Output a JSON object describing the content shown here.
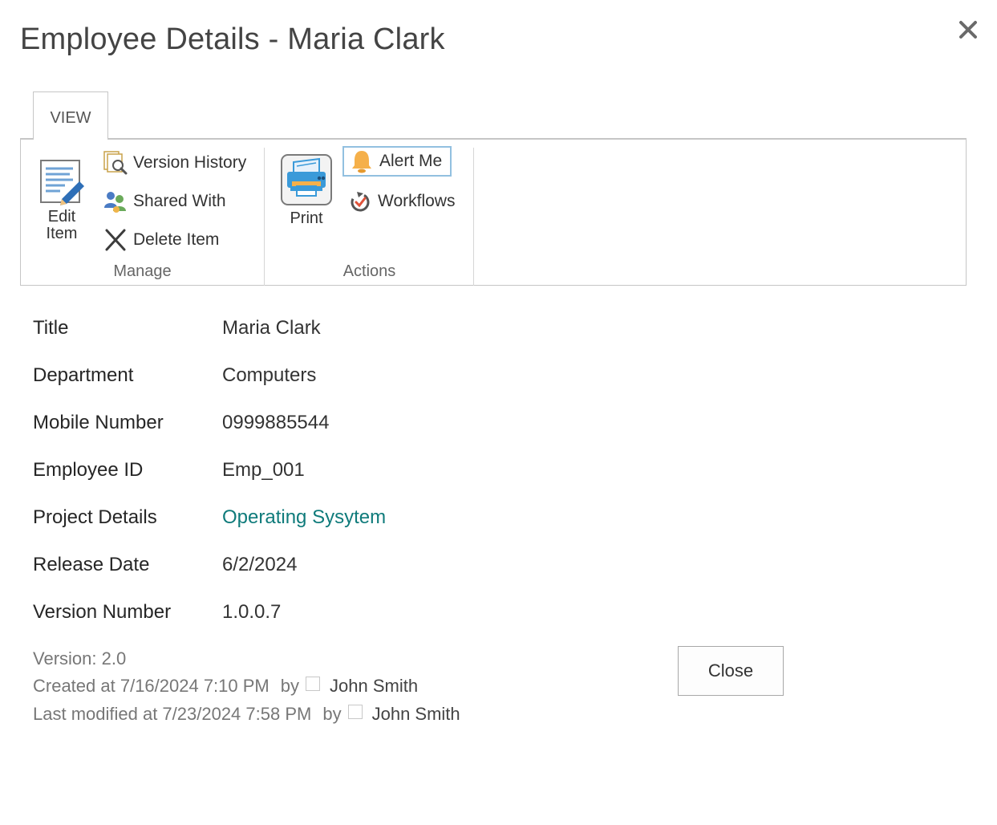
{
  "dialog": {
    "title": "Employee Details - Maria Clark",
    "close_icon": "close-x-icon"
  },
  "ribbon": {
    "tab_label": "VIEW",
    "groups": {
      "manage": {
        "label": "Manage",
        "edit_item_line1": "Edit",
        "edit_item_line2": "Item",
        "version_history": "Version History",
        "shared_with": "Shared With",
        "delete_item": "Delete Item"
      },
      "actions": {
        "label": "Actions",
        "print": "Print",
        "alert_me": "Alert Me",
        "workflows": "Workflows"
      }
    }
  },
  "fields": [
    {
      "label": "Title",
      "value": "Maria Clark"
    },
    {
      "label": "Department",
      "value": "Computers"
    },
    {
      "label": "Mobile Number",
      "value": "0999885544"
    },
    {
      "label": "Employee ID",
      "value": "Emp_001"
    },
    {
      "label": "Project Details",
      "value": "Operating Sysytem"
    },
    {
      "label": "Release Date",
      "value": "6/2/2024"
    },
    {
      "label": "Version Number",
      "value": "1.0.0.7"
    }
  ],
  "meta": {
    "version": "Version: 2.0",
    "created": "Created at 7/16/2024 7:10 PM",
    "created_by_label": "by",
    "created_by": "John Smith",
    "modified": "Last modified at 7/23/2024 7:58 PM",
    "modified_by_label": "by",
    "modified_by": "John Smith"
  },
  "buttons": {
    "close": "Close"
  },
  "colors": {
    "link": "#0f7b7b",
    "alert_selected_border": "#92c0e0",
    "print_icon_blue": "#3a9ad9",
    "bell_orange": "#f5b04a"
  }
}
